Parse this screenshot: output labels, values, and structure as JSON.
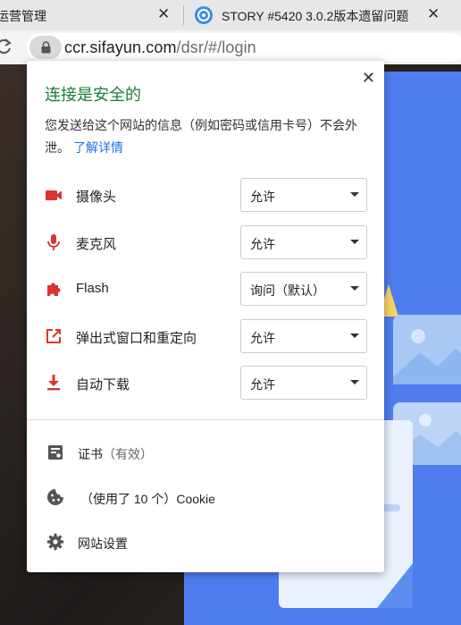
{
  "tabs": [
    {
      "label": "运营管理",
      "close": "✕"
    },
    {
      "label": "STORY #5420 3.0.2版本遗留问题",
      "close": "✕"
    }
  ],
  "address_bar": {
    "host": "ccr.sifayun.com",
    "path": "/dsr/#/login"
  },
  "popup": {
    "close": "✕",
    "title": "连接是安全的",
    "description": "您发送给这个网站的信息（例如密码或信用卡号）不会外泄。",
    "learn_more": "了解详情",
    "permissions": [
      {
        "icon": "camera-icon",
        "label": "摄像头",
        "value": "允许"
      },
      {
        "icon": "microphone-icon",
        "label": "麦克风",
        "value": "允许"
      },
      {
        "icon": "flash-puzzle-icon",
        "label": "Flash",
        "value": "询问（默认）"
      },
      {
        "icon": "popup-redirect-icon",
        "label": "弹出式窗口和重定向",
        "value": "允许"
      },
      {
        "icon": "download-icon",
        "label": "自动下载",
        "value": "允许"
      }
    ],
    "footer": {
      "certificate": {
        "label": "证书",
        "status": "（有效）"
      },
      "cookies": {
        "label": "（使用了 10 个）Cookie"
      },
      "site_settings": {
        "label": "网站设置"
      }
    }
  },
  "colors": {
    "secure_green": "#188038",
    "link_blue": "#1a73e8",
    "permission_red": "#d33"
  }
}
